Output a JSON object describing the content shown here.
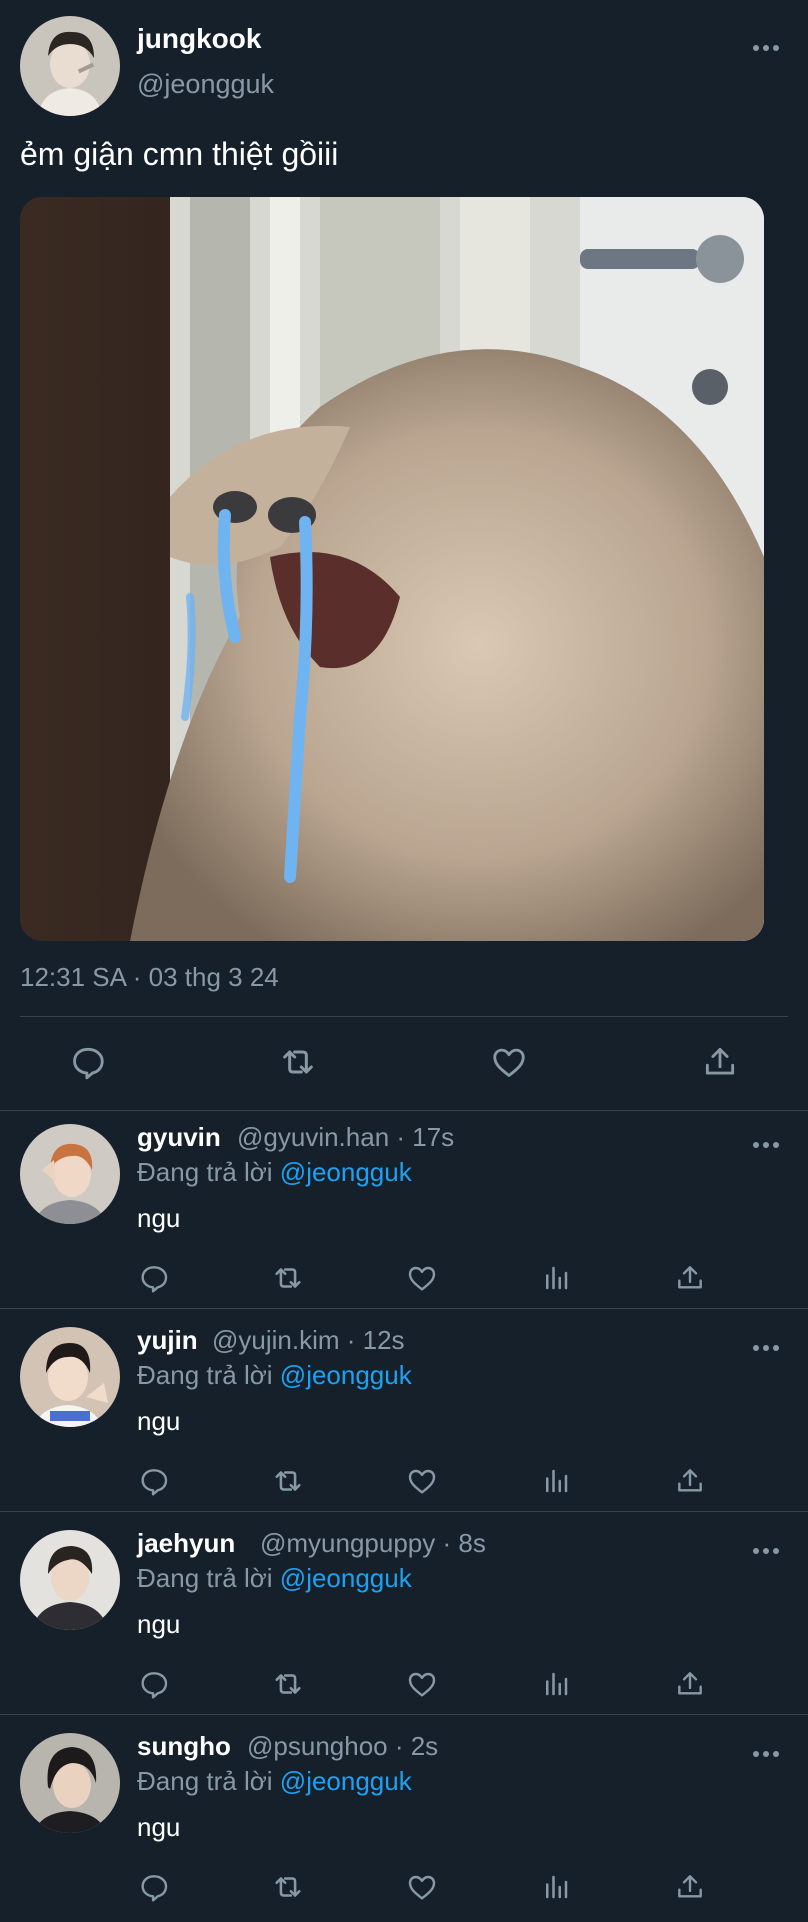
{
  "tweet": {
    "display_name": "jungkook",
    "handle": "@jeongguk",
    "text": "ẻm giận cmn thiệt gồiii",
    "timestamp": "12:31 SA · 03 thg 3 24",
    "more_icon": "more-horizontal-icon",
    "actions": [
      "reply-icon",
      "retweet-icon",
      "like-icon",
      "share-icon"
    ]
  },
  "replies": [
    {
      "display_name": "gyuvin",
      "meta": "@gyuvin.han · 17s",
      "replying_prefix": "Đang trả lời",
      "replying_to": "@jeongguk",
      "text": "ngu"
    },
    {
      "display_name": "yujin",
      "meta": "@yujin.kim · 12s",
      "replying_prefix": "Đang trả lời",
      "replying_to": "@jeongguk",
      "text": "ngu"
    },
    {
      "display_name": "jaehyun",
      "meta": "@myungpuppy · 8s",
      "replying_prefix": "Đang trả lời",
      "replying_to": "@jeongguk",
      "text": "ngu"
    },
    {
      "display_name": "sungho",
      "meta": "@psunghoo · 2s",
      "replying_prefix": "Đang trả lời",
      "replying_to": "@jeongguk",
      "text": "ngu"
    }
  ],
  "colors": {
    "background": "#15202b",
    "secondary_text": "#8899a6",
    "link": "#1da1f2",
    "divider": "#38444d"
  }
}
